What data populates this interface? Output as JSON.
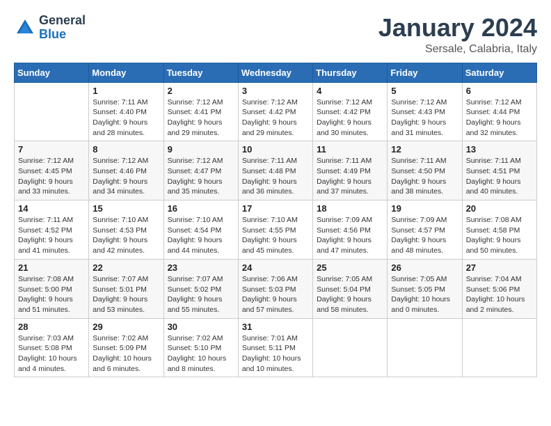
{
  "logo": {
    "general": "General",
    "blue": "Blue"
  },
  "header": {
    "month": "January 2024",
    "location": "Sersale, Calabria, Italy"
  },
  "weekdays": [
    "Sunday",
    "Monday",
    "Tuesday",
    "Wednesday",
    "Thursday",
    "Friday",
    "Saturday"
  ],
  "weeks": [
    [
      {
        "day": "",
        "sunrise": "",
        "sunset": "",
        "daylight": ""
      },
      {
        "day": "1",
        "sunrise": "Sunrise: 7:11 AM",
        "sunset": "Sunset: 4:40 PM",
        "daylight": "Daylight: 9 hours and 28 minutes."
      },
      {
        "day": "2",
        "sunrise": "Sunrise: 7:12 AM",
        "sunset": "Sunset: 4:41 PM",
        "daylight": "Daylight: 9 hours and 29 minutes."
      },
      {
        "day": "3",
        "sunrise": "Sunrise: 7:12 AM",
        "sunset": "Sunset: 4:42 PM",
        "daylight": "Daylight: 9 hours and 29 minutes."
      },
      {
        "day": "4",
        "sunrise": "Sunrise: 7:12 AM",
        "sunset": "Sunset: 4:42 PM",
        "daylight": "Daylight: 9 hours and 30 minutes."
      },
      {
        "day": "5",
        "sunrise": "Sunrise: 7:12 AM",
        "sunset": "Sunset: 4:43 PM",
        "daylight": "Daylight: 9 hours and 31 minutes."
      },
      {
        "day": "6",
        "sunrise": "Sunrise: 7:12 AM",
        "sunset": "Sunset: 4:44 PM",
        "daylight": "Daylight: 9 hours and 32 minutes."
      }
    ],
    [
      {
        "day": "7",
        "sunrise": "Sunrise: 7:12 AM",
        "sunset": "Sunset: 4:45 PM",
        "daylight": "Daylight: 9 hours and 33 minutes."
      },
      {
        "day": "8",
        "sunrise": "Sunrise: 7:12 AM",
        "sunset": "Sunset: 4:46 PM",
        "daylight": "Daylight: 9 hours and 34 minutes."
      },
      {
        "day": "9",
        "sunrise": "Sunrise: 7:12 AM",
        "sunset": "Sunset: 4:47 PM",
        "daylight": "Daylight: 9 hours and 35 minutes."
      },
      {
        "day": "10",
        "sunrise": "Sunrise: 7:11 AM",
        "sunset": "Sunset: 4:48 PM",
        "daylight": "Daylight: 9 hours and 36 minutes."
      },
      {
        "day": "11",
        "sunrise": "Sunrise: 7:11 AM",
        "sunset": "Sunset: 4:49 PM",
        "daylight": "Daylight: 9 hours and 37 minutes."
      },
      {
        "day": "12",
        "sunrise": "Sunrise: 7:11 AM",
        "sunset": "Sunset: 4:50 PM",
        "daylight": "Daylight: 9 hours and 38 minutes."
      },
      {
        "day": "13",
        "sunrise": "Sunrise: 7:11 AM",
        "sunset": "Sunset: 4:51 PM",
        "daylight": "Daylight: 9 hours and 40 minutes."
      }
    ],
    [
      {
        "day": "14",
        "sunrise": "Sunrise: 7:11 AM",
        "sunset": "Sunset: 4:52 PM",
        "daylight": "Daylight: 9 hours and 41 minutes."
      },
      {
        "day": "15",
        "sunrise": "Sunrise: 7:10 AM",
        "sunset": "Sunset: 4:53 PM",
        "daylight": "Daylight: 9 hours and 42 minutes."
      },
      {
        "day": "16",
        "sunrise": "Sunrise: 7:10 AM",
        "sunset": "Sunset: 4:54 PM",
        "daylight": "Daylight: 9 hours and 44 minutes."
      },
      {
        "day": "17",
        "sunrise": "Sunrise: 7:10 AM",
        "sunset": "Sunset: 4:55 PM",
        "daylight": "Daylight: 9 hours and 45 minutes."
      },
      {
        "day": "18",
        "sunrise": "Sunrise: 7:09 AM",
        "sunset": "Sunset: 4:56 PM",
        "daylight": "Daylight: 9 hours and 47 minutes."
      },
      {
        "day": "19",
        "sunrise": "Sunrise: 7:09 AM",
        "sunset": "Sunset: 4:57 PM",
        "daylight": "Daylight: 9 hours and 48 minutes."
      },
      {
        "day": "20",
        "sunrise": "Sunrise: 7:08 AM",
        "sunset": "Sunset: 4:58 PM",
        "daylight": "Daylight: 9 hours and 50 minutes."
      }
    ],
    [
      {
        "day": "21",
        "sunrise": "Sunrise: 7:08 AM",
        "sunset": "Sunset: 5:00 PM",
        "daylight": "Daylight: 9 hours and 51 minutes."
      },
      {
        "day": "22",
        "sunrise": "Sunrise: 7:07 AM",
        "sunset": "Sunset: 5:01 PM",
        "daylight": "Daylight: 9 hours and 53 minutes."
      },
      {
        "day": "23",
        "sunrise": "Sunrise: 7:07 AM",
        "sunset": "Sunset: 5:02 PM",
        "daylight": "Daylight: 9 hours and 55 minutes."
      },
      {
        "day": "24",
        "sunrise": "Sunrise: 7:06 AM",
        "sunset": "Sunset: 5:03 PM",
        "daylight": "Daylight: 9 hours and 57 minutes."
      },
      {
        "day": "25",
        "sunrise": "Sunrise: 7:05 AM",
        "sunset": "Sunset: 5:04 PM",
        "daylight": "Daylight: 9 hours and 58 minutes."
      },
      {
        "day": "26",
        "sunrise": "Sunrise: 7:05 AM",
        "sunset": "Sunset: 5:05 PM",
        "daylight": "Daylight: 10 hours and 0 minutes."
      },
      {
        "day": "27",
        "sunrise": "Sunrise: 7:04 AM",
        "sunset": "Sunset: 5:06 PM",
        "daylight": "Daylight: 10 hours and 2 minutes."
      }
    ],
    [
      {
        "day": "28",
        "sunrise": "Sunrise: 7:03 AM",
        "sunset": "Sunset: 5:08 PM",
        "daylight": "Daylight: 10 hours and 4 minutes."
      },
      {
        "day": "29",
        "sunrise": "Sunrise: 7:02 AM",
        "sunset": "Sunset: 5:09 PM",
        "daylight": "Daylight: 10 hours and 6 minutes."
      },
      {
        "day": "30",
        "sunrise": "Sunrise: 7:02 AM",
        "sunset": "Sunset: 5:10 PM",
        "daylight": "Daylight: 10 hours and 8 minutes."
      },
      {
        "day": "31",
        "sunrise": "Sunrise: 7:01 AM",
        "sunset": "Sunset: 5:11 PM",
        "daylight": "Daylight: 10 hours and 10 minutes."
      },
      {
        "day": "",
        "sunrise": "",
        "sunset": "",
        "daylight": ""
      },
      {
        "day": "",
        "sunrise": "",
        "sunset": "",
        "daylight": ""
      },
      {
        "day": "",
        "sunrise": "",
        "sunset": "",
        "daylight": ""
      }
    ]
  ]
}
